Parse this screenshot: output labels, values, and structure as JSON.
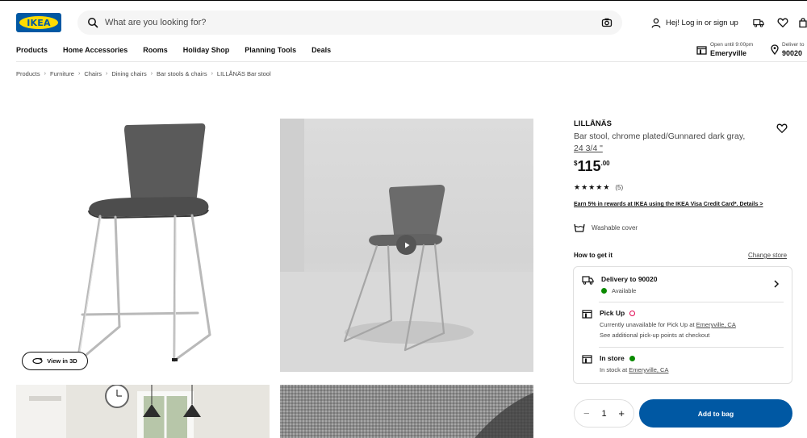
{
  "header": {
    "logo_text": "IKEA",
    "search_placeholder": "What are you looking for?",
    "login_label": "Hej! Log in or sign up"
  },
  "nav": {
    "items": [
      "Products",
      "Home Accessories",
      "Rooms",
      "Holiday Shop",
      "Planning Tools",
      "Deals"
    ],
    "store_hours": "Open until 9:00pm",
    "store_name": "Emeryville",
    "deliver_label": "Deliver to",
    "deliver_zip": "90020"
  },
  "breadcrumbs": [
    "Products",
    "Furniture",
    "Chairs",
    "Dining chairs",
    "Bar stools & chairs",
    "LILLÅNÄS Bar stool"
  ],
  "gallery": {
    "view3d_label": "View in 3D"
  },
  "product": {
    "name": "LILLÅNÄS",
    "description": "Bar stool, chrome plated/Gunnared dark gray,",
    "size": "24 3/4 \"",
    "price_currency": "$",
    "price_int": "115",
    "price_dec": ".00",
    "rating": 5,
    "review_count": "(5)",
    "rewards_text": "Earn 5% in rewards at IKEA using the IKEA Visa Credit Card*. Details >",
    "feature": "Washable cover"
  },
  "availability": {
    "heading": "How to get it",
    "change_store": "Change store",
    "delivery_title": "Delivery to 90020",
    "delivery_status": "Available",
    "pickup_title": "Pick Up",
    "pickup_status_prefix": "Currently unavailable for Pick Up at",
    "pickup_store": "Emeryville, CA",
    "pickup_more": "See additional pick-up points at checkout",
    "instore_title": "In store",
    "instore_prefix": "In stock at",
    "instore_store": "Emeryville, CA"
  },
  "purchase": {
    "quantity": "1",
    "minus": "−",
    "plus": "+",
    "add_label": "Add to bag"
  },
  "colors": {
    "brand_blue": "#0058a3",
    "brand_yellow": "#ffdb00",
    "available_green": "#0a8a00",
    "unavailable_red": "#e00751"
  }
}
